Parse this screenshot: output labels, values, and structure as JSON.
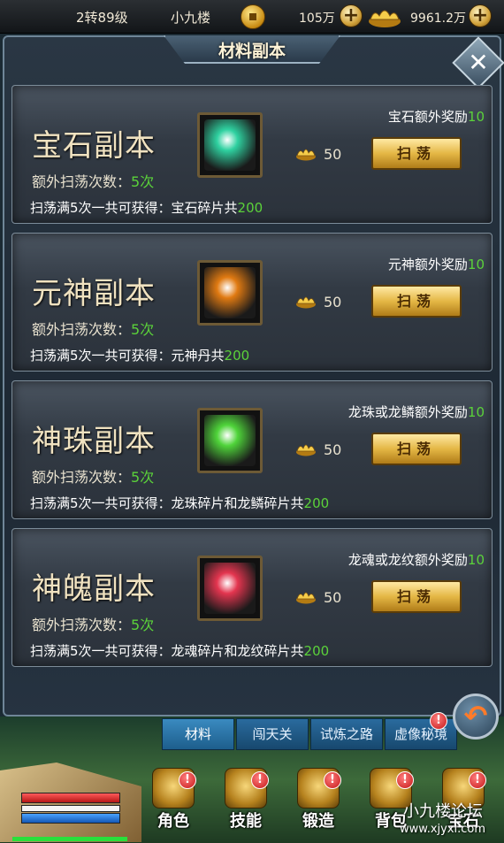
{
  "topbar": {
    "level": "2转89级",
    "player_name": "小九楼",
    "coins": "105万",
    "ingots": "9961.2万"
  },
  "panel": {
    "title": "材料副本"
  },
  "dungeons": [
    {
      "title": "宝石副本",
      "extra_label": "额外扫荡次数：",
      "extra_count": "5次",
      "cost": "50",
      "reward_label": "宝石额外奖励",
      "reward_num": "10",
      "sweep_label": "扫荡",
      "total_label": "扫荡满5次一共可获得：宝石碎片共",
      "total_num": "200",
      "item_icon": "gem-shard-icon",
      "item_color": "#2fd1a0"
    },
    {
      "title": "元神副本",
      "extra_label": "额外扫荡次数：",
      "extra_count": "5次",
      "cost": "50",
      "reward_label": "元神额外奖励",
      "reward_num": "10",
      "sweep_label": "扫荡",
      "total_label": "扫荡满5次一共可获得：元神丹共",
      "total_num": "200",
      "item_icon": "spirit-pill-icon",
      "item_color": "#e07a12"
    },
    {
      "title": "神珠副本",
      "extra_label": "额外扫荡次数：",
      "extra_count": "5次",
      "cost": "50",
      "reward_label": "龙珠或龙鳞额外奖励",
      "reward_num": "10",
      "sweep_label": "扫荡",
      "total_label": "扫荡满5次一共可获得：龙珠碎片和龙鳞碎片共",
      "total_num": "200",
      "item_icon": "green-orb-icon",
      "item_color": "#4fd43a"
    },
    {
      "title": "神魄副本",
      "extra_label": "额外扫荡次数：",
      "extra_count": "5次",
      "cost": "50",
      "reward_label": "龙魂或龙纹额外奖励",
      "reward_num": "10",
      "sweep_label": "扫荡",
      "total_label": "扫荡满5次一共可获得：龙魂碎片和龙纹碎片共",
      "total_num": "200",
      "item_icon": "red-orb-icon",
      "item_color": "#e3354f"
    }
  ],
  "tabs": [
    "材料",
    "闯天关",
    "试炼之路",
    "虚像秘境"
  ],
  "nav": [
    "角色",
    "技能",
    "锻造",
    "背包",
    "宝石"
  ],
  "watermark": {
    "site_name": "小九楼论坛",
    "url": "www.xjyxl.com"
  },
  "colors": {
    "accent_green": "#5bd23a",
    "button_gold": "#e4b745",
    "tab_blue": "#2a6b9e"
  }
}
